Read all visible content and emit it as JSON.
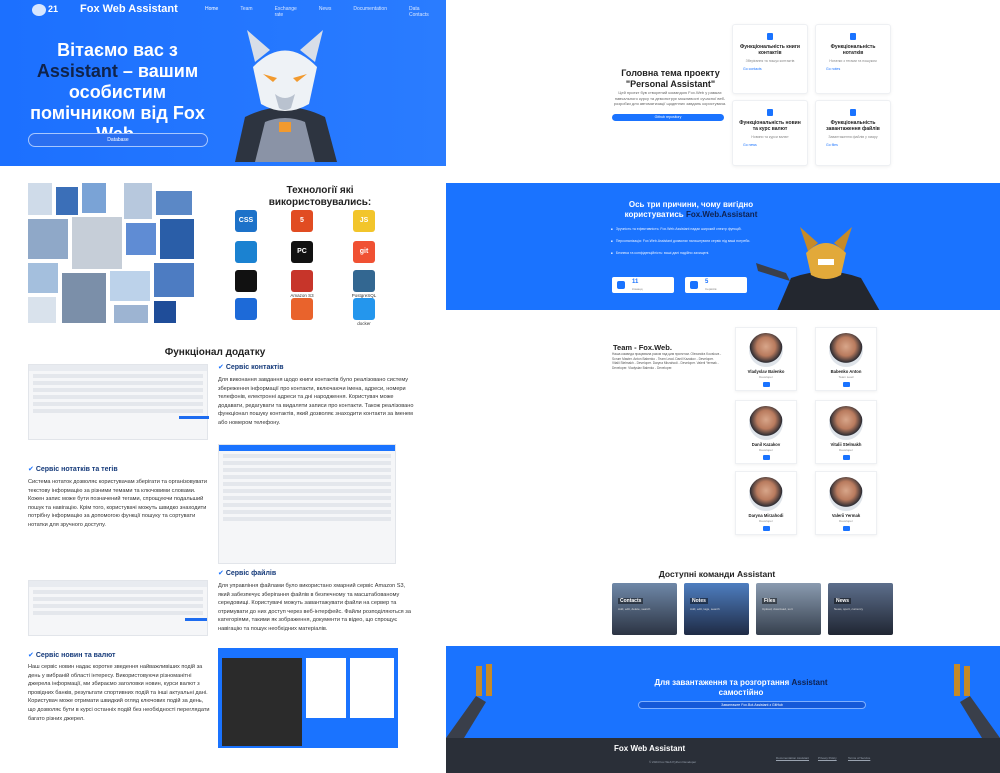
{
  "nav": {
    "version": "21",
    "brand": "Fox Web Assistant",
    "items": [
      "Home",
      "Team",
      "Exchange rate",
      "News",
      "Documentation",
      "Data Contacts"
    ]
  },
  "hero": {
    "title_a": "Вітаємо вас з",
    "title_highlight": "Assistant",
    "title_b": "– вашим особистим помічником від Fox Web",
    "title_dot": ".",
    "button": "Database"
  },
  "tech": {
    "title": "Технології які використовувались:",
    "items": [
      {
        "icon": "css-icon",
        "label": "CSS",
        "color": "#1d72c9",
        "caption": ""
      },
      {
        "icon": "html-icon",
        "label": "5",
        "color": "#e14c22",
        "caption": ""
      },
      {
        "icon": "js-icon",
        "label": "JS",
        "color": "#f2c52b",
        "caption": ""
      },
      {
        "icon": "vscode-icon",
        "label": "",
        "color": "#1b82d1",
        "caption": ""
      },
      {
        "icon": "pycharm-icon",
        "label": "PC",
        "color": "#111",
        "caption": ""
      },
      {
        "icon": "git-icon",
        "label": "git",
        "color": "#f05133",
        "caption": ""
      },
      {
        "icon": "github-icon",
        "label": "",
        "color": "#111",
        "caption": ""
      },
      {
        "icon": "amazon-s3-icon",
        "label": "",
        "color": "#c7352a",
        "caption": "Amazon S3"
      },
      {
        "icon": "postgresql-icon",
        "label": "",
        "color": "#336791",
        "caption": "PostgreSQL"
      },
      {
        "icon": "trello-icon",
        "label": "",
        "color": "#1d6ad8",
        "caption": ""
      },
      {
        "icon": "grafana-icon",
        "label": "",
        "color": "#e9632c",
        "caption": ""
      },
      {
        "icon": "docker-icon",
        "label": "",
        "color": "#2496ed",
        "caption": "docker"
      }
    ]
  },
  "functionality": {
    "title": "Функціонал додатку",
    "contacts": {
      "heading": "Сервіс контактів",
      "text": "Для виконання завдання щодо книги контактів було реалізовано систему збереження інформації про контакти, включаючи імена, адреси, номери телефонів, електронні адреси та дні народження. Користувач може додавати, редагувати та видаляти записи про контакти. Також реалізовано функціонал пошуку контактів, який дозволяє знаходити контакти за іменем або номером телефону."
    },
    "notes": {
      "heading": "Сервіс нотатків та тегів",
      "text": "Система нотаток дозволяє користувачам зберігати та організовувати текстову інформацію за різними темами та ключовими словами. Кожен запис може бути позначений тегами, спрощуючи подальший пошук та навігацію. Крім того, користувачі можуть швидко знаходити потрібну інформацію за допомогою функції пошуку та сортувати нотатки для зручного доступу."
    },
    "files": {
      "heading": "Сервіс файлів",
      "text": "Для управління файлами було використано хмарний сервіс Amazon S3, який забезпечує зберігання файлів в безпечному та масштабованому середовищі. Користувачі можуть завантажувати файли на сервер та отримувати до них доступ через веб-інтерфейс. Файли розподіляються за категоріями, такими як зображення, документи та відео, що спрощує навігацію та пошук необхідних матеріалів."
    },
    "news": {
      "heading": "Сервіс новин та валют",
      "text": "Наш сервіс новин надає коротке зведення найважливіших подій за день у вибраній області інтересу. Використовуючи різноманітні джерела інформації, ми збираємо заголовки новин, курси валют з провідних банків, результати спортивних подій та інші актуальні дані. Користувач може отримати швидкий огляд ключових подій за день, що дозволяє бути в курсі останніх подій без необхідності переглядати багато різних джерел."
    }
  },
  "project": {
    "title": "Головна тема проекту \"Personal Assistant\"",
    "text": "Цей проект був створений командою Fox.Web у рамках навчального курсу та демонструє можливості сучасної веб-розробки для автоматизації щоденних завдань користувача.",
    "button": "Github repository",
    "cards": [
      {
        "title": "Функціональність книги контактів",
        "desc": "Зберігання та пошук контактів",
        "link": "Go contacts"
      },
      {
        "title": "Функціональність нотатків",
        "desc": "Нотатки з тегами та пошуком",
        "link": "Go notes"
      },
      {
        "title": "Функціональність новин та курс валют",
        "desc": "Новини та курси валют",
        "link": "Go news"
      },
      {
        "title": "Функціональність завантаження файлів",
        "desc": "Завантаження файлів у хмару",
        "link": "Go files"
      }
    ]
  },
  "reasons": {
    "title_a": "Ось три причини, чому вигідно користуватись",
    "title_highlight": "Fox.Web.Assistant",
    "items": [
      "Зручність та ефективність: Fox.Web.Assistant надає широкий спектр функцій.",
      "Персоналізація: Fox.Web.Assistant дозволяє налаштувати сервіс під ваші потреби.",
      "Безпека та конфіденційність: ваші дані надійно захищені."
    ],
    "stats": [
      {
        "num": "11",
        "cap": "Команд"
      },
      {
        "num": "5",
        "cap": "Сервісів"
      }
    ]
  },
  "team": {
    "title": "Team - Fox.Web.",
    "text": "Наша команда працювала разом над цим проектом. Olexandra Kovalova - Scrum Master. Anton Babenko - Team Lead. Danil Kazakov - Developer. Vitalii Stelmakh - Developer. Daryna Mirzahodi - Developer. Valerii Yermak - Developer. Vladyslav Balenko - Developer.",
    "members": [
      {
        "name": "Vladyslav Balenko",
        "role": "Developer"
      },
      {
        "name": "Babenko Anton",
        "role": "Team Lead"
      },
      {
        "name": "Danil Kazakov",
        "role": "Developer"
      },
      {
        "name": "Vitalii Stelmakh",
        "role": "Developer"
      },
      {
        "name": "Daryna Mirzahodi",
        "role": "Developer"
      },
      {
        "name": "Valerii Yermak",
        "role": "Developer"
      }
    ]
  },
  "commands": {
    "title": "Доступні команди Assistant",
    "items": [
      {
        "tag": "Contacts",
        "sub": "Add, edit, delete, search"
      },
      {
        "tag": "Notes",
        "sub": "Add, edit, tags, search"
      },
      {
        "tag": "Files",
        "sub": "Upload, download, sort"
      },
      {
        "tag": "News",
        "sub": "News, sport, currency"
      }
    ]
  },
  "deploy": {
    "title_a": "Для завантаження та розгортання",
    "title_highlight": "Assistant",
    "title_b": "самостійно",
    "button": "Завантажте Fox.Bot.Assistant з GitHub"
  },
  "footer": {
    "brand": "Fox Web Assistant",
    "copyright": "© 2024 Fox Web Python Developer",
    "links": [
      "Documentation Assistant",
      "Privacy Policy",
      "Terms of Service"
    ]
  }
}
